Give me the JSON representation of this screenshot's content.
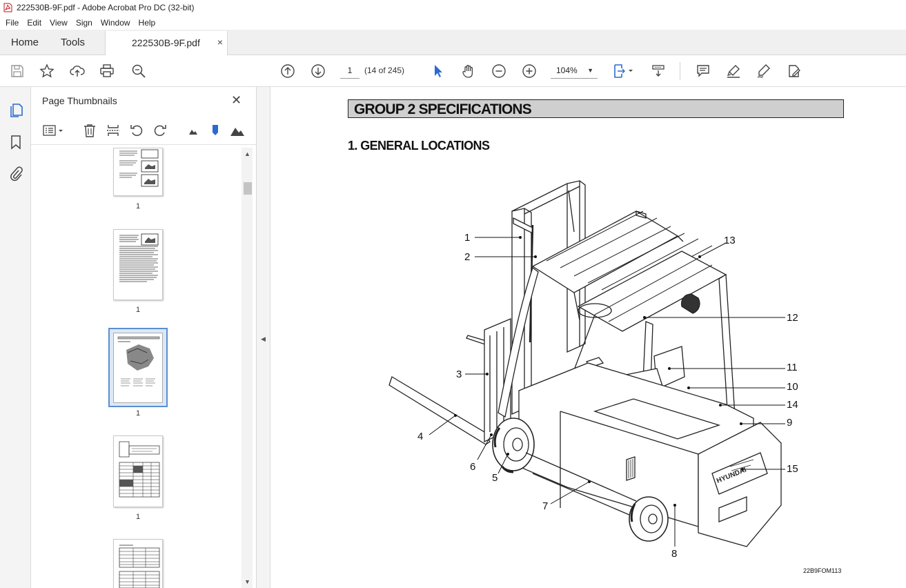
{
  "window": {
    "title": "222530B-9F.pdf - Adobe Acrobat Pro DC (32-bit)"
  },
  "menu": {
    "items": [
      "File",
      "Edit",
      "View",
      "Sign",
      "Window",
      "Help"
    ]
  },
  "tabs": {
    "home": "Home",
    "tools": "Tools",
    "document": "222530B-9F.pdf",
    "close_glyph": "×"
  },
  "toolbar": {
    "page_input": "1",
    "page_count": "(14 of 245)",
    "zoom": "104%",
    "icons": [
      "save-icon",
      "star-icon",
      "upload-icon",
      "print-icon",
      "search-zoom-icon",
      "page-up-icon",
      "page-down-icon",
      "select-cursor-icon",
      "hand-icon",
      "zoom-out-icon",
      "zoom-in-icon",
      "page-fit-icon",
      "scroll-mode-icon",
      "comment-icon",
      "highlight-icon",
      "draw-icon",
      "sign-icon"
    ]
  },
  "panel": {
    "title": "Page Thumbnails",
    "close_glyph": "✕",
    "thumb_labels": [
      "1",
      "1",
      "1",
      "1"
    ]
  },
  "document": {
    "group_header": "GROUP 2  SPECIFICATIONS",
    "section_title": "1. GENERAL LOCATIONS",
    "callouts": [
      "1",
      "2",
      "3",
      "4",
      "5",
      "6",
      "7",
      "8",
      "9",
      "10",
      "11",
      "12",
      "13",
      "14",
      "15"
    ],
    "figure_code": "22B9FOM113",
    "brand_on_counterweight": "HYUNDAI"
  }
}
